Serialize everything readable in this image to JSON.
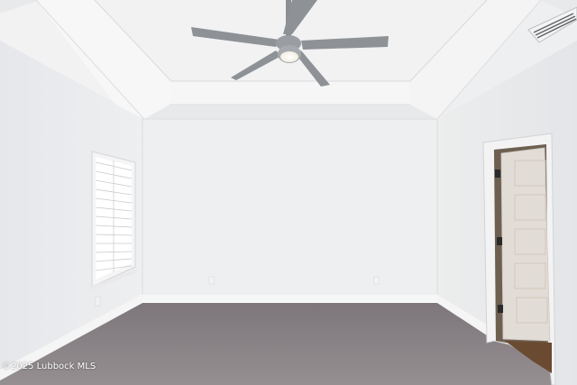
{
  "scene": {
    "subject": "empty bedroom with ceiling fan",
    "watermark": "©2025 Lubbock MLS",
    "colors": {
      "walls": "#ebecee",
      "ceiling": "#f1f1f2",
      "carpet": "#8a8387",
      "door": "#e2dcd6",
      "fan": "#8e9296"
    },
    "elements": [
      "tray-ceiling",
      "ceiling-fan",
      "air-vent",
      "window-with-blinds",
      "interior-door",
      "baseboards",
      "carpet-floor"
    ]
  }
}
